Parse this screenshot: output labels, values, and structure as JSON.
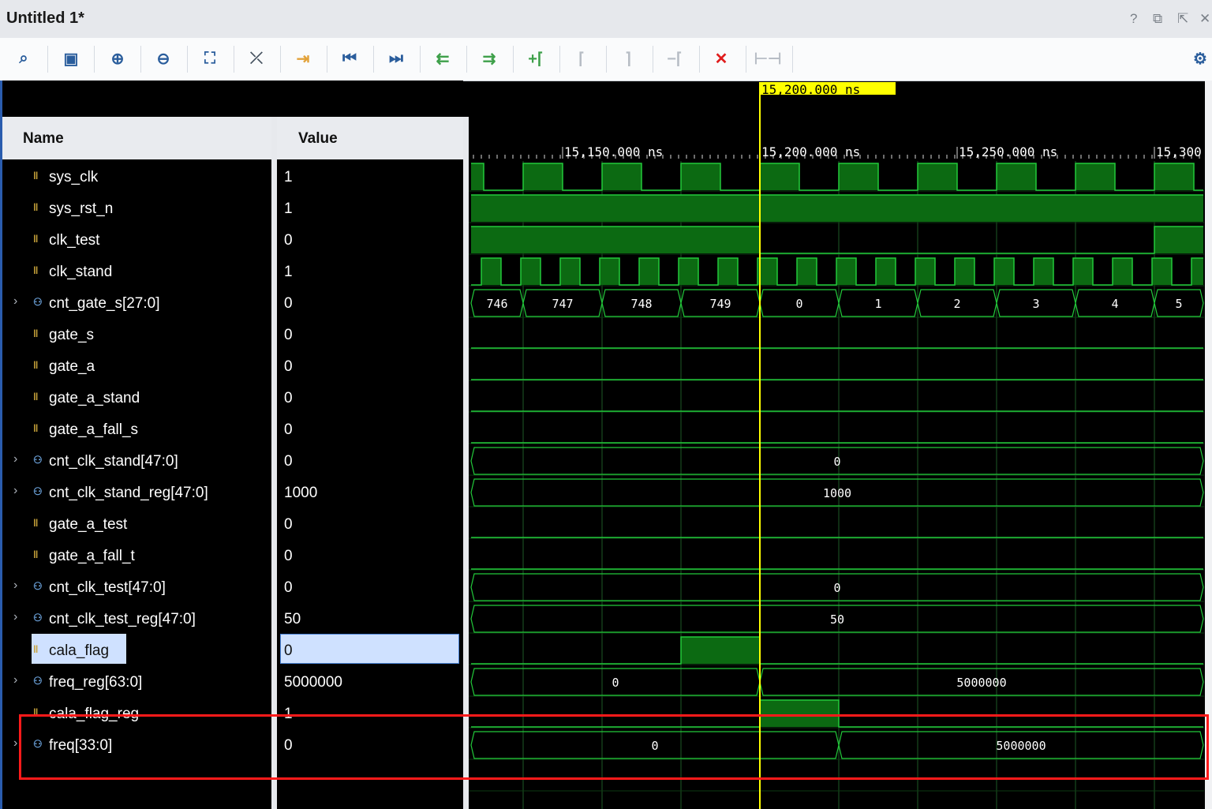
{
  "window": {
    "title": "Untitled 1*",
    "help": "?",
    "restore": "⧉",
    "float": "⇱",
    "close": "✕"
  },
  "toolbar": {
    "items": [
      {
        "name": "search-icon",
        "glyph": "⌕",
        "color": "#2a5d9c"
      },
      {
        "name": "save-icon",
        "glyph": "▣",
        "color": "#2a5d9c"
      },
      {
        "name": "zoom-in-icon",
        "glyph": "⊕",
        "color": "#2a5d9c"
      },
      {
        "name": "zoom-out-icon",
        "glyph": "⊖",
        "color": "#2a5d9c"
      },
      {
        "name": "zoom-fit-icon",
        "glyph": "⛶",
        "color": "#2a5d9c"
      },
      {
        "name": "cursor-snap-icon",
        "glyph": "⤫",
        "color": "#44505e"
      },
      {
        "name": "go-to-cursor-icon",
        "glyph": "⇥",
        "color": "#e2a23a"
      },
      {
        "name": "go-to-time-zero-icon",
        "glyph": "⏮",
        "color": "#2a5d9c"
      },
      {
        "name": "go-to-last-time-icon",
        "glyph": "⏭",
        "color": "#2a5d9c"
      },
      {
        "name": "previous-transition-icon",
        "glyph": "⇇",
        "color": "#3ea04a"
      },
      {
        "name": "next-transition-icon",
        "glyph": "⇉",
        "color": "#3ea04a"
      },
      {
        "name": "add-marker-icon",
        "glyph": "+⌈",
        "color": "#3ea04a"
      },
      {
        "name": "previous-marker-icon",
        "glyph": "⌈",
        "color": "#b7bdc5"
      },
      {
        "name": "next-marker-icon",
        "glyph": "⌉",
        "color": "#b7bdc5"
      },
      {
        "name": "delete-marker-icon",
        "glyph": "−⌈",
        "color": "#b7bdc5"
      },
      {
        "name": "delete-all-markers-icon",
        "glyph": "✕",
        "color": "#e01c1c"
      },
      {
        "name": "swap-cursors-icon",
        "glyph": "⊢⊣",
        "color": "#b7bdc5"
      }
    ],
    "settings_icon": "⚙"
  },
  "columns": {
    "name": "Name",
    "value": "Value"
  },
  "signals": [
    {
      "name": "sys_clk",
      "value": "1",
      "kind": "scalar"
    },
    {
      "name": "sys_rst_n",
      "value": "1",
      "kind": "scalar"
    },
    {
      "name": "clk_test",
      "value": "0",
      "kind": "scalar"
    },
    {
      "name": "clk_stand",
      "value": "1",
      "kind": "scalar"
    },
    {
      "name": "cnt_gate_s[27:0]",
      "value": "0",
      "kind": "vector"
    },
    {
      "name": "gate_s",
      "value": "0",
      "kind": "scalar"
    },
    {
      "name": "gate_a",
      "value": "0",
      "kind": "scalar"
    },
    {
      "name": "gate_a_stand",
      "value": "0",
      "kind": "scalar"
    },
    {
      "name": "gate_a_fall_s",
      "value": "0",
      "kind": "scalar"
    },
    {
      "name": "cnt_clk_stand[47:0]",
      "value": "0",
      "kind": "vector"
    },
    {
      "name": "cnt_clk_stand_reg[47:0]",
      "value": "1000",
      "kind": "vector"
    },
    {
      "name": "gate_a_test",
      "value": "0",
      "kind": "scalar"
    },
    {
      "name": "gate_a_fall_t",
      "value": "0",
      "kind": "scalar"
    },
    {
      "name": "cnt_clk_test[47:0]",
      "value": "0",
      "kind": "vector"
    },
    {
      "name": "cnt_clk_test_reg[47:0]",
      "value": "50",
      "kind": "vector"
    },
    {
      "name": "cala_flag",
      "value": "0",
      "kind": "scalar"
    },
    {
      "name": "freq_reg[63:0]",
      "value": "5000000",
      "kind": "vector"
    },
    {
      "name": "cala_flag_reg",
      "value": "1",
      "kind": "scalar"
    },
    {
      "name": "freq[33:0]",
      "value": "0",
      "kind": "vector"
    }
  ],
  "selected_signal": "cala_flag",
  "timeline": {
    "cursor_label": "15,200.000 ns",
    "tick_labels": [
      "15,150.000 ns",
      "15,200.000 ns",
      "15,250.000 ns",
      "15,300"
    ]
  },
  "colors": {
    "wave": "#22c93a",
    "wave_fill": "#0c6a12",
    "grid": "#1e5a26",
    "cursor": "#ffff00",
    "highlight": "#ff1a1a"
  },
  "waves": {
    "cnt_gate_s": [
      {
        "label": "746"
      },
      {
        "label": "747"
      },
      {
        "label": "748"
      },
      {
        "label": "749"
      },
      {
        "label": "0"
      },
      {
        "label": "1"
      },
      {
        "label": "2"
      },
      {
        "label": "3"
      },
      {
        "label": "4"
      },
      {
        "label": "5"
      }
    ],
    "cnt_clk_stand": [
      {
        "label": "0"
      }
    ],
    "cnt_clk_stand_reg": [
      {
        "label": "1000"
      }
    ],
    "cnt_clk_test": [
      {
        "label": "0"
      }
    ],
    "cnt_clk_test_reg": [
      {
        "label": "50"
      }
    ],
    "freq_reg": [
      {
        "label": "0"
      },
      {
        "label": "5000000"
      }
    ],
    "freq": [
      {
        "label": "0"
      },
      {
        "label": "5000000"
      }
    ]
  }
}
